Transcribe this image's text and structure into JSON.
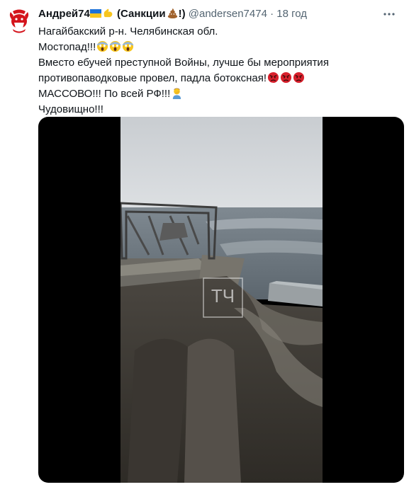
{
  "author": {
    "name": "Андрей74",
    "sanctions_prefix": "(Санкции",
    "sanctions_suffix": "!)",
    "handle": "@andersen7474",
    "separator": "·",
    "time": "18 год"
  },
  "tweet": {
    "line1": "Нагайбакский р-н. Челябинская обл.",
    "line2": "Мостопад!!!",
    "line3a": "Вместо ебучей преступной Войны, лучше бы мероприятия",
    "line3b": "противопаводковые провел, падла ботоксная!",
    "line4": "МАССОВО!!! По всей РФ!!!",
    "line5": "Чудовищно!!!"
  },
  "media": {
    "watermark": "ТЧ"
  },
  "colors": {
    "text": "#0f1419",
    "muted": "#536471",
    "media_bg": "#000000"
  }
}
